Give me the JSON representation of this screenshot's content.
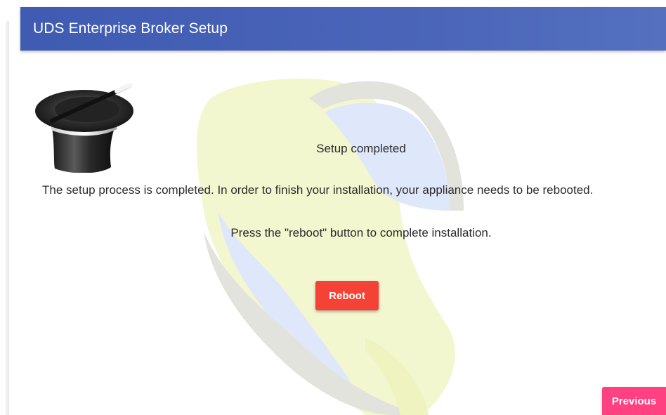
{
  "header": {
    "title": "UDS Enterprise Broker Setup"
  },
  "content": {
    "status_title": "Setup completed",
    "description": "The setup process is completed. In order to finish your installation, your appliance needs to be rebooted.",
    "instruction": "Press the \"reboot\" button to complete installation."
  },
  "buttons": {
    "reboot_label": "Reboot",
    "previous_label": "Previous"
  },
  "icons": {
    "wizard_hat": "magic-hat-icon",
    "watermark": "uds-logo-watermark"
  },
  "colors": {
    "header": "#4a65b8",
    "reboot": "#f44336",
    "previous": "#ff4081",
    "watermark_yellow": "#f1f6c4",
    "watermark_blue": "#dde6fa",
    "watermark_gray": "#e3e3df"
  }
}
